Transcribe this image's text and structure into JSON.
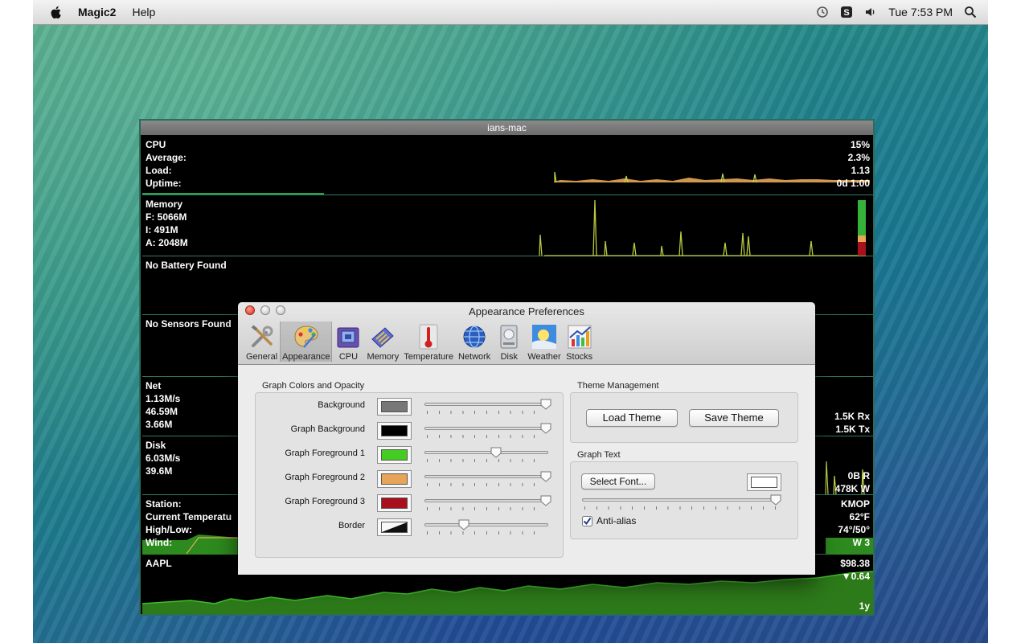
{
  "menubar": {
    "app_name": "Magic2",
    "menus": [
      "Help"
    ],
    "clock": "Tue 7:53 PM",
    "icons": [
      "apple-icon",
      "time-machine-icon",
      "skype-icon",
      "volume-icon",
      "spotlight-icon"
    ]
  },
  "monitor": {
    "title": "ians-mac",
    "cpu": {
      "labels": [
        "CPU",
        "Average:",
        "Load:",
        "Uptime:"
      ],
      "values": [
        "15%",
        "2.3%",
        "1.13",
        "0d 1:00"
      ]
    },
    "memory": {
      "labels": [
        "Memory",
        "F: 5066M",
        "I: 491M",
        "A: 2048M"
      ]
    },
    "battery": {
      "label": "No Battery Found"
    },
    "sensors": {
      "label": "No Sensors Found"
    },
    "net": {
      "labels": [
        "Net",
        "1.13M/s",
        "46.59M",
        "3.66M"
      ],
      "values": [
        "1.5K Rx",
        "1.5K Tx"
      ]
    },
    "disk": {
      "labels": [
        "Disk",
        "6.03M/s",
        "39.6M"
      ],
      "values": [
        "0B R",
        "478K W"
      ]
    },
    "weather": {
      "labels": [
        "Station:",
        "Current Temperatu",
        "High/Low:",
        "Wind:"
      ],
      "values": [
        "KMOP",
        "62°F",
        "74°/50°",
        "W 3"
      ]
    },
    "stocks": {
      "labels": [
        "AAPL"
      ],
      "values": [
        "$98.38",
        "▼0.64"
      ],
      "range": "1y"
    }
  },
  "prefs": {
    "title": "Appearance Preferences",
    "toolbar": [
      {
        "label": "General",
        "icon": "tools-icon"
      },
      {
        "label": "Appearance",
        "icon": "palette-icon",
        "selected": true
      },
      {
        "label": "CPU",
        "icon": "cpu-chip-icon"
      },
      {
        "label": "Memory",
        "icon": "memory-stick-icon"
      },
      {
        "label": "Temperature",
        "icon": "thermometer-icon"
      },
      {
        "label": "Network",
        "icon": "globe-icon"
      },
      {
        "label": "Disk",
        "icon": "disk-drive-icon"
      },
      {
        "label": "Weather",
        "icon": "weather-sun-icon"
      },
      {
        "label": "Stocks",
        "icon": "stock-chart-icon"
      }
    ],
    "graph_colors": {
      "title": "Graph Colors and Opacity",
      "rows": [
        {
          "label": "Background",
          "color": "#777777",
          "opacity": 0.98
        },
        {
          "label": "Graph Background",
          "color": "#000000",
          "opacity": 0.98
        },
        {
          "label": "Graph Foreground 1",
          "color": "#44cc22",
          "opacity": 0.58
        },
        {
          "label": "Graph Foreground 2",
          "color": "#e8a55a",
          "opacity": 0.98
        },
        {
          "label": "Graph Foreground 3",
          "color": "#a8101e",
          "opacity": 0.98
        },
        {
          "label": "Border",
          "color": "#111111",
          "opacity": 0.32
        }
      ]
    },
    "theme": {
      "title": "Theme Management",
      "load_label": "Load Theme",
      "save_label": "Save Theme"
    },
    "graph_text": {
      "title": "Graph Text",
      "select_font_label": "Select Font...",
      "text_color": "#ffffff",
      "opacity": 0.98,
      "anti_alias_label": "Anti-alias",
      "anti_alias_checked": true
    }
  }
}
